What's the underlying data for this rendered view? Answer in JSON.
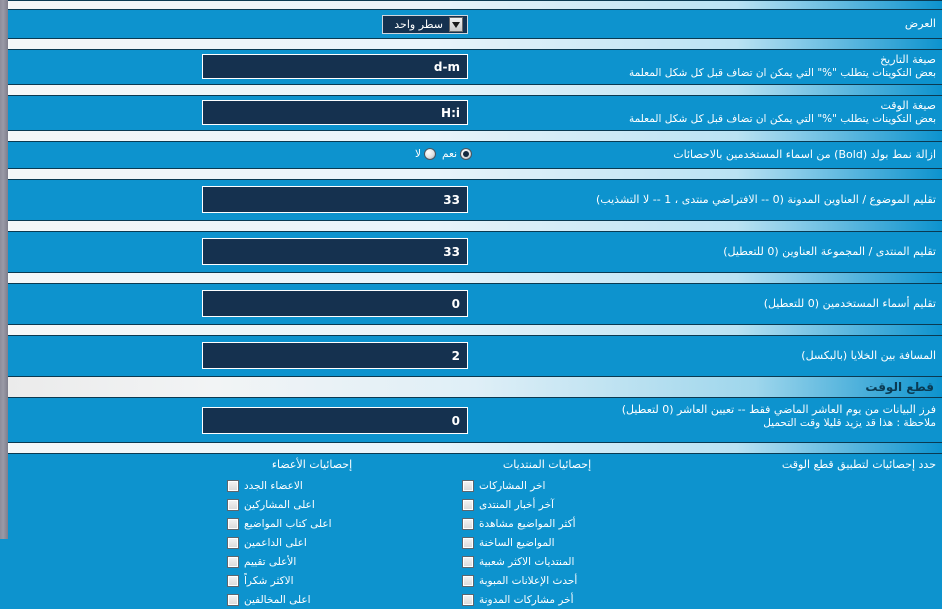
{
  "page": {
    "direction": "rtl",
    "background_color": "#0d93ce",
    "field_color": "#15314f",
    "accent_color": "#0a3a52"
  },
  "rows": {
    "display": {
      "label": "العرض",
      "select_value": "سطر واحد",
      "select_options": [
        "سطر واحد"
      ]
    },
    "date_format": {
      "label": "صيغة التاريخ",
      "desc": "بعض التكوينات يتطلب  \"%\"  التي يمكن ان تضاف قبل كل شكل المعلمة",
      "value": "d-m"
    },
    "time_format": {
      "label": "صيغة الوقت",
      "desc": "بعض التكوينات يتطلب  \"%\"  التي يمكن ان تضاف قبل كل شكل المعلمة",
      "value": "H:i"
    },
    "remove_bold": {
      "label": "ازالة نمط بولد (Bold) من اسماء المستخدمين بالاحصائات",
      "yes_label": "نعم",
      "no_label": "لا",
      "selected": "نعم"
    },
    "trim_thread_titles": {
      "label": "تقليم الموضوع / العناوين المدونة (0 -- الافتراضي منتدى ، 1 -- لا التشذيب)",
      "value": "33"
    },
    "trim_forum_titles": {
      "label": "تقليم المنتدى / المجموعة العناوين (0 للتعطيل)",
      "value": "33"
    },
    "trim_usernames": {
      "label": "تقليم أسماء المستخدمين (0 للتعطيل)",
      "value": "0"
    },
    "cell_spacing": {
      "label": "المسافة بين الخلايا (بالبكسل)",
      "value": "2"
    },
    "time_cut_section": {
      "title": "قطع الوقت"
    },
    "time_cut_value": {
      "label": "فرز البيانات من يوم العاشر الماضي فقط -- تعيين العاشر (0 لتعطيل)",
      "desc": "ملاحظة : هذا قد يزيد قليلا وقت التحميل",
      "value": "0"
    }
  },
  "checkbox_section": {
    "label": "حدد إحصائيات لتطبيق قطع الوقت",
    "columns": [
      {
        "header": "إحصائيات المنتديات",
        "items": [
          {
            "label": "اخر المشاركات",
            "checked": false
          },
          {
            "label": "آخر أخبار المنتدى",
            "checked": false
          },
          {
            "label": "أكثر المواضيع مشاهدة",
            "checked": false
          },
          {
            "label": "المواضيع الساخنة",
            "checked": false
          },
          {
            "label": "المنتديات الاكثر شعبية",
            "checked": false
          },
          {
            "label": "أحدث الإعلانات المبوبة",
            "checked": false
          },
          {
            "label": "أخر مشاركات المدونة",
            "checked": false
          }
        ]
      },
      {
        "header": "إحصائيات الأعضاء",
        "items": [
          {
            "label": "الاعضاء الجدد",
            "checked": false
          },
          {
            "label": "اعلى المشاركين",
            "checked": false
          },
          {
            "label": "اعلى كتاب المواضيع",
            "checked": false
          },
          {
            "label": "اعلى الداعمين",
            "checked": false
          },
          {
            "label": "الأعلى تقييم",
            "checked": false
          },
          {
            "label": "الاكثر شكراً",
            "checked": false
          },
          {
            "label": "اعلى المخالفين",
            "checked": false
          }
        ]
      }
    ]
  }
}
